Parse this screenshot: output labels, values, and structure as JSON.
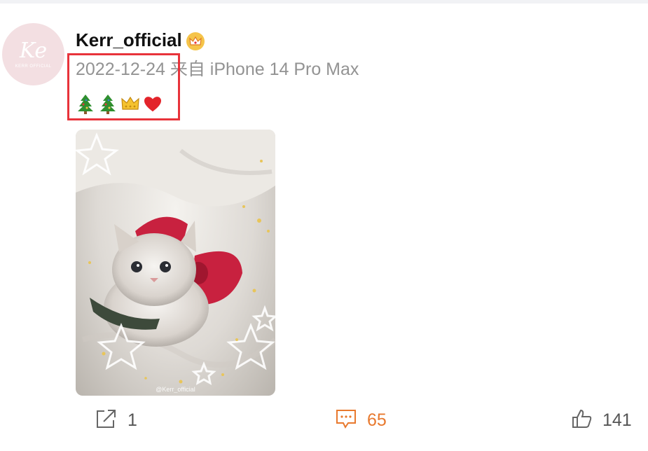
{
  "post": {
    "author": {
      "name": "Kerr_official",
      "avatar_mark": "Ke",
      "avatar_tag": "KERR OFFICIAL",
      "badge": "crown-badge-icon"
    },
    "date": "2022-12-24",
    "source": "来自 iPhone 14 Pro Max",
    "emojis": [
      "christmas-tree-icon",
      "christmas-tree-icon",
      "crown-icon",
      "red-heart-icon"
    ],
    "image": {
      "description_icon": "kitten-photo",
      "watermark": "@Kerr_official"
    }
  },
  "actions": {
    "share": {
      "icon": "share-icon",
      "count": "1"
    },
    "comment": {
      "icon": "comment-icon",
      "count": "65"
    },
    "like": {
      "icon": "thumbs-up-icon",
      "count": "141"
    }
  },
  "colors": {
    "highlight": "#e8333b",
    "comment_accent": "#e8792e",
    "meta_text": "#939393",
    "avatar_bg": "#f3dfe2"
  }
}
